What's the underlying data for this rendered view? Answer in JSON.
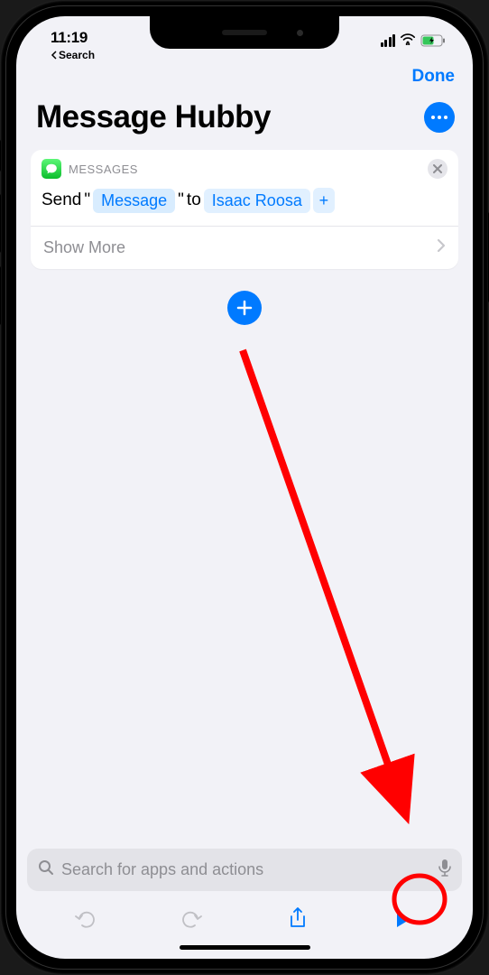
{
  "status": {
    "time": "11:19",
    "back_label": "Search"
  },
  "nav": {
    "done": "Done"
  },
  "title": "Message Hubby",
  "action": {
    "app_name": "MESSAGES",
    "send_prefix": "Send",
    "quote_open": "\"",
    "message_token": "Message",
    "quote_close": "\"",
    "to": "to",
    "recipient": "Isaac Roosa",
    "show_more": "Show More"
  },
  "search": {
    "placeholder": "Search for apps and actions"
  }
}
